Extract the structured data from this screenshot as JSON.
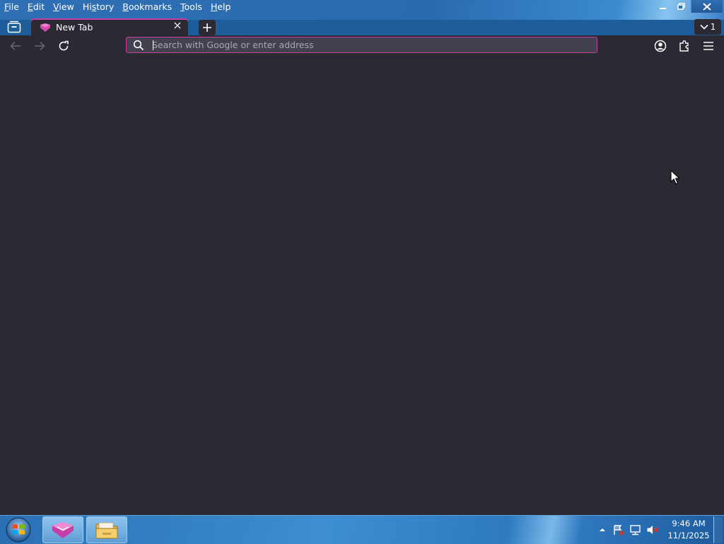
{
  "menubar": {
    "items": [
      {
        "pre": "",
        "ul": "F",
        "post": "ile"
      },
      {
        "pre": "",
        "ul": "E",
        "post": "dit"
      },
      {
        "pre": "",
        "ul": "V",
        "post": "iew"
      },
      {
        "pre": "Hi",
        "ul": "s",
        "post": "tory"
      },
      {
        "pre": "",
        "ul": "B",
        "post": "ookmarks"
      },
      {
        "pre": "",
        "ul": "T",
        "post": "ools"
      },
      {
        "pre": "",
        "ul": "H",
        "post": "elp"
      }
    ]
  },
  "window_controls": {
    "minimize": "minimize-icon",
    "restore": "restore-icon",
    "close": "close-icon"
  },
  "tabs": {
    "active": {
      "title": "New Tab",
      "favicon": "browser-logo-icon"
    },
    "count_label": "1"
  },
  "urlbar": {
    "placeholder": "Search with Google or enter address",
    "value": ""
  },
  "colors": {
    "accent": "#c73fa6",
    "toolbar": "#2b2a33",
    "content": "#2b2a33",
    "urlbar_bg": "#42414d"
  },
  "taskbar": {
    "clock": {
      "time": "9:46 AM",
      "date": "11/1/2025"
    },
    "pinned": [
      "browser-icon",
      "file-explorer-icon"
    ],
    "tray": [
      "show-hidden-icons",
      "action-center-flag-icon",
      "network-icon",
      "volume-muted-icon"
    ]
  }
}
